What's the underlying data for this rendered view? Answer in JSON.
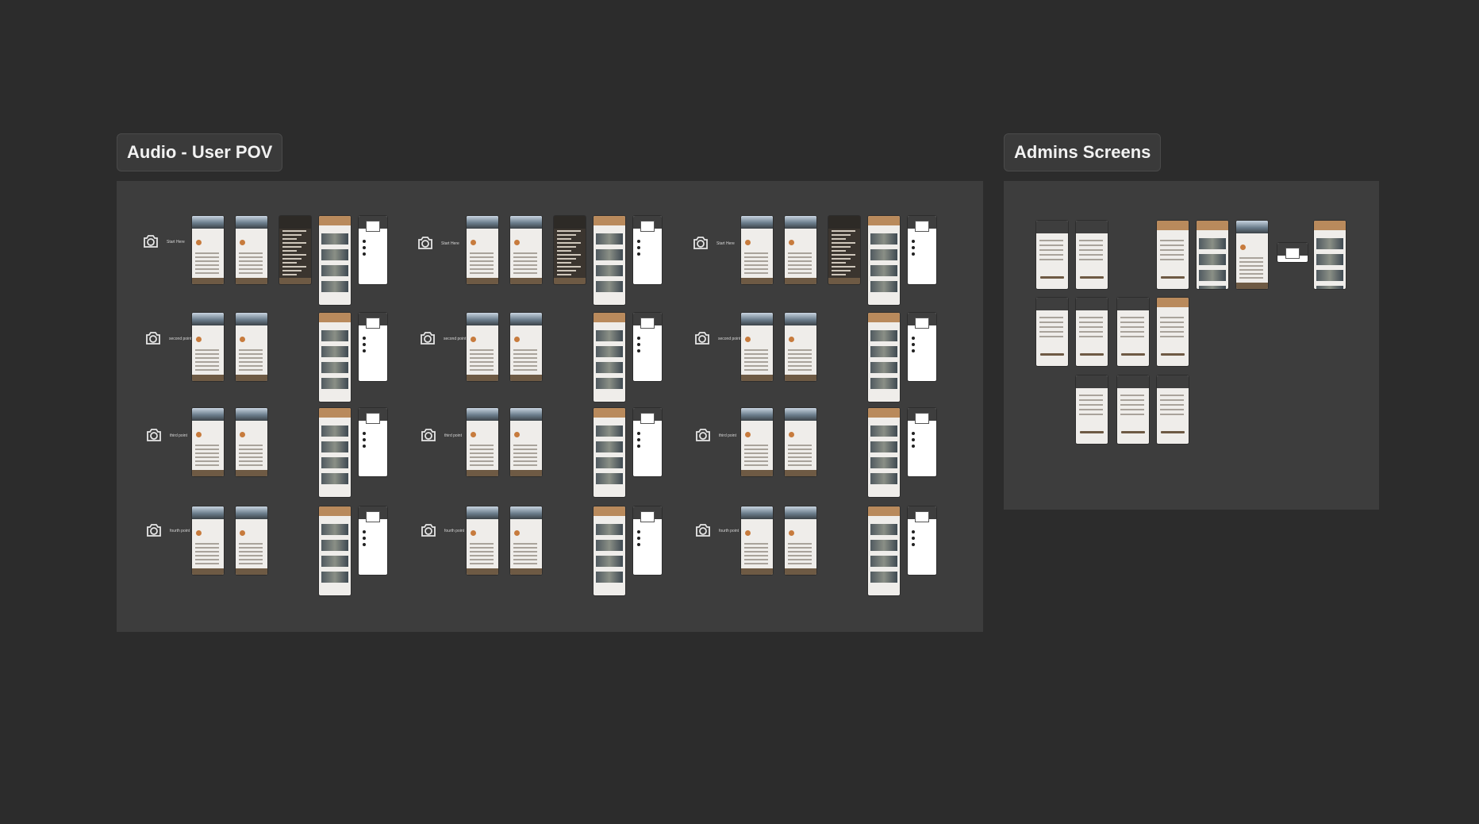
{
  "sections": [
    {
      "title": "Audio - User POV"
    },
    {
      "title": "Admins Screens"
    }
  ],
  "row_labels": [
    [
      "Start Here",
      "Start Here",
      "Start Here"
    ],
    [
      "second point",
      "second point",
      "second point"
    ],
    [
      "third point",
      "third point",
      "third point"
    ],
    [
      "fourth point",
      "fourth point",
      "fourth point"
    ]
  ],
  "icons": {
    "row_marker": "camera-icon"
  },
  "colors": {
    "canvas": "#2c2c2c",
    "frame": "#3d3d3d",
    "accent_brown": "#b98a5c",
    "footer_brown": "#6e5a44"
  }
}
